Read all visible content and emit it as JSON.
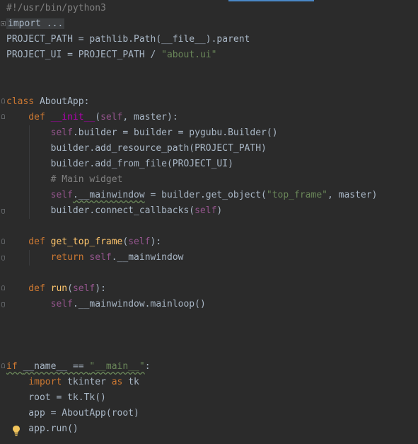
{
  "editor": {
    "lines": [
      [
        {
          "t": "#!/usr/bin/python3",
          "c": "com"
        }
      ],
      [
        {
          "t": "import ...",
          "c": "fold-placeholder"
        }
      ],
      [
        {
          "t": "PROJECT_PATH = pathlib.Path(__file__).parent",
          "c": "plain"
        }
      ],
      [
        {
          "t": "PROJECT_UI = PROJECT_PATH / ",
          "c": "plain"
        },
        {
          "t": "\"about.ui\"",
          "c": "str"
        }
      ],
      [],
      [],
      [
        {
          "t": "class ",
          "c": "kw"
        },
        {
          "t": "AboutApp:",
          "c": "plain"
        }
      ],
      [
        {
          "t": "    def ",
          "c": "kw"
        },
        {
          "t": "__init__",
          "c": "dunder"
        },
        {
          "t": "(",
          "c": "plain"
        },
        {
          "t": "self",
          "c": "self"
        },
        {
          "t": ", master):",
          "c": "plain"
        }
      ],
      [
        {
          "t": "        ",
          "c": "plain"
        },
        {
          "t": "self",
          "c": "self"
        },
        {
          "t": ".builder = builder = pygubu.Builder()",
          "c": "plain"
        }
      ],
      [
        {
          "t": "        builder.add_resource_path(PROJECT_PATH)",
          "c": "plain"
        }
      ],
      [
        {
          "t": "        builder.add_from_file(PROJECT_UI)",
          "c": "plain"
        }
      ],
      [
        {
          "t": "        # Main widget",
          "c": "com"
        }
      ],
      [
        {
          "t": "        ",
          "c": "plain"
        },
        {
          "t": "self",
          "c": "self"
        },
        {
          "t": ".__mainwindow",
          "c": "plain wavy"
        },
        {
          "t": " = builder.get_object(",
          "c": "plain"
        },
        {
          "t": "\"top_frame\"",
          "c": "str"
        },
        {
          "t": ", master)",
          "c": "plain"
        }
      ],
      [
        {
          "t": "        builder.connect_callbacks(",
          "c": "plain"
        },
        {
          "t": "self",
          "c": "self"
        },
        {
          "t": ")",
          "c": "plain"
        }
      ],
      [],
      [
        {
          "t": "    def ",
          "c": "kw"
        },
        {
          "t": "get_top_frame",
          "c": "fn"
        },
        {
          "t": "(",
          "c": "plain"
        },
        {
          "t": "self",
          "c": "self"
        },
        {
          "t": "):",
          "c": "plain"
        }
      ],
      [
        {
          "t": "        ",
          "c": "plain"
        },
        {
          "t": "return ",
          "c": "kw"
        },
        {
          "t": "self",
          "c": "self"
        },
        {
          "t": ".__mainwindow",
          "c": "plain"
        }
      ],
      [],
      [
        {
          "t": "    def ",
          "c": "kw"
        },
        {
          "t": "run",
          "c": "fn"
        },
        {
          "t": "(",
          "c": "plain"
        },
        {
          "t": "self",
          "c": "self"
        },
        {
          "t": "):",
          "c": "plain"
        }
      ],
      [
        {
          "t": "        ",
          "c": "plain"
        },
        {
          "t": "self",
          "c": "self"
        },
        {
          "t": ".__mainwindow.mainloop()",
          "c": "plain"
        }
      ],
      [],
      [],
      [],
      [
        {
          "t": "if ",
          "c": "kw wavy"
        },
        {
          "t": "__name__ == ",
          "c": "plain wavy"
        },
        {
          "t": "\"__main__\"",
          "c": "str wavy"
        },
        {
          "t": ":",
          "c": "plain"
        }
      ],
      [
        {
          "t": "    ",
          "c": "plain"
        },
        {
          "t": "import ",
          "c": "kw"
        },
        {
          "t": "tkinter ",
          "c": "plain"
        },
        {
          "t": "as ",
          "c": "kw"
        },
        {
          "t": "tk",
          "c": "plain"
        }
      ],
      [
        {
          "t": "    root = tk.Tk()",
          "c": "plain"
        }
      ],
      [
        {
          "t": "    app = AboutApp(root)",
          "c": "plain"
        }
      ],
      [
        {
          "t": "    app.run()",
          "c": "plain"
        }
      ]
    ]
  },
  "colors": {
    "background": "#2b2b2b",
    "text": "#a9b7c6",
    "keyword": "#cc7832",
    "self": "#94558d",
    "string": "#6a8759",
    "comment": "#808080",
    "function": "#ffc66d",
    "dunder": "#b200b2",
    "bulb": "#f2c55c"
  },
  "icons": {
    "intention": "lightbulb-icon",
    "fold": "fold-marker-icon"
  }
}
